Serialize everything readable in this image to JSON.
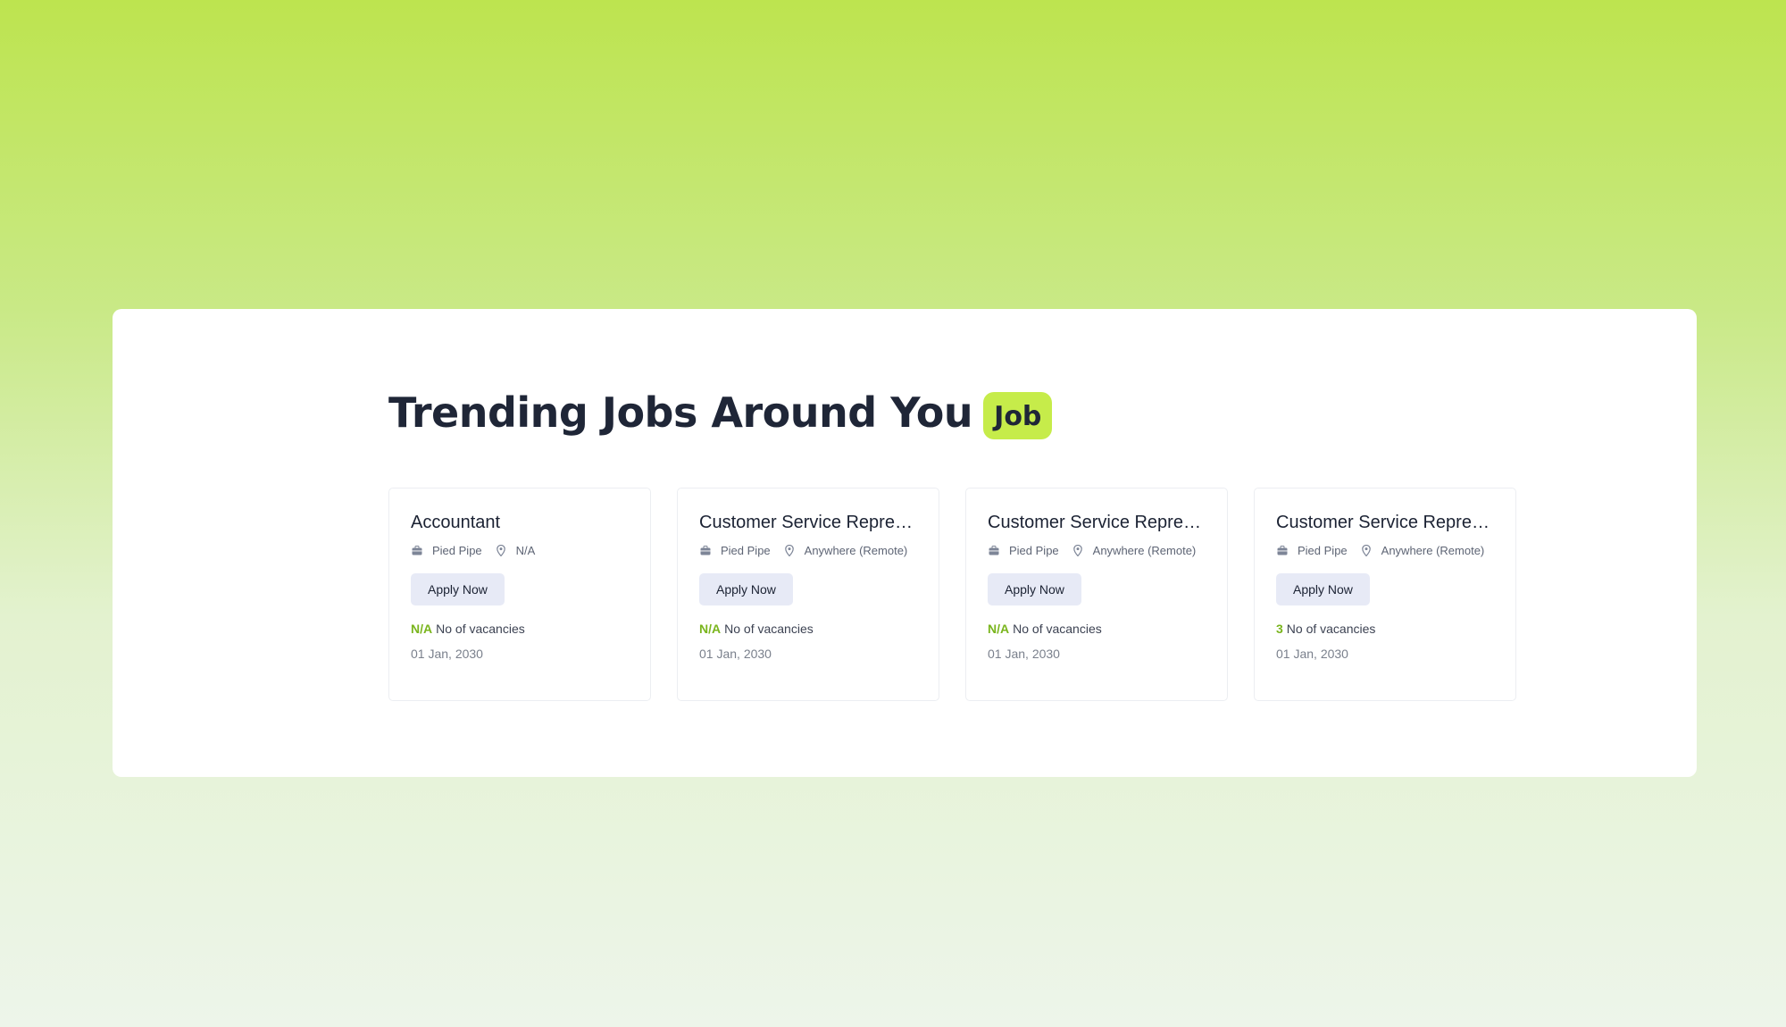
{
  "section": {
    "heading": "Trending Jobs Around You",
    "badge": "Job"
  },
  "jobs": [
    {
      "title": "Accountant",
      "company": "Pied Pipe",
      "location": "N/A",
      "apply_label": "Apply Now",
      "vacancies_count": "N/A",
      "vacancies_label": "No of vacancies",
      "date": "01 Jan, 2030"
    },
    {
      "title": "Customer Service Repres...",
      "company": "Pied Pipe",
      "location": "Anywhere (Remote)",
      "apply_label": "Apply Now",
      "vacancies_count": "N/A",
      "vacancies_label": "No of vacancies",
      "date": "01 Jan, 2030"
    },
    {
      "title": "Customer Service Repres...",
      "company": "Pied Pipe",
      "location": "Anywhere (Remote)",
      "apply_label": "Apply Now",
      "vacancies_count": "N/A",
      "vacancies_label": "No of vacancies",
      "date": "01 Jan, 2030"
    },
    {
      "title": "Customer Service Repres...",
      "company": "Pied Pipe",
      "location": "Anywhere (Remote)",
      "apply_label": "Apply Now",
      "vacancies_count": "3",
      "vacancies_label": "No of vacancies",
      "date": "01 Jan, 2030"
    }
  ],
  "icons": {
    "company": "briefcase-icon",
    "location": "map-pin-icon"
  },
  "colors": {
    "accent": "#c6ec4a",
    "count": "#7ab51d",
    "button_bg": "#e7eaf6",
    "heading": "#1f2637"
  }
}
